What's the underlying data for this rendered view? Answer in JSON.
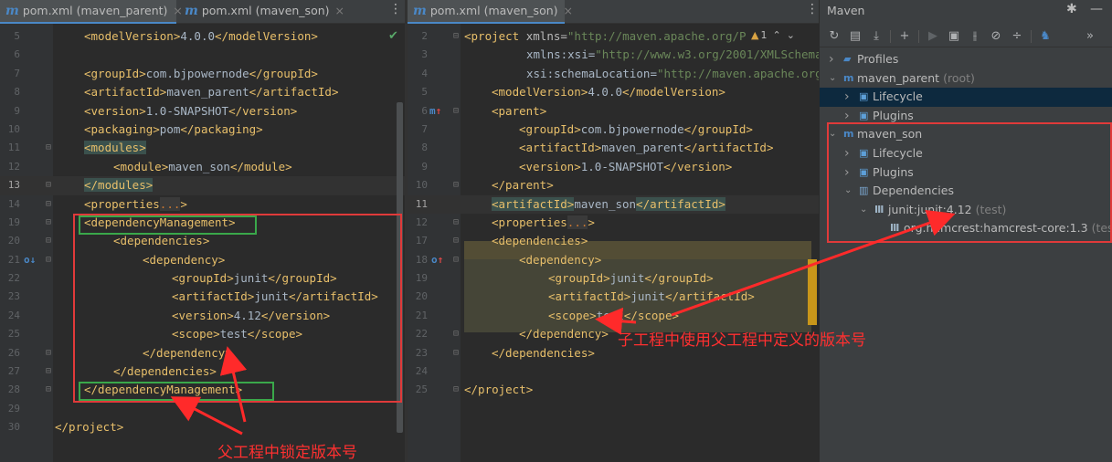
{
  "left_editor": {
    "tabs": [
      {
        "label": "pom.xml (maven_parent)",
        "active": true
      },
      {
        "label": "pom.xml (maven_son)",
        "active": false
      }
    ],
    "lines": [
      {
        "n": "5",
        "t": "<modelVersion>4.0.0</modelVersion>"
      },
      {
        "n": "6",
        "t": ""
      },
      {
        "n": "7",
        "t": "<groupId>com.bjpowernode</groupId>"
      },
      {
        "n": "8",
        "t": "<artifactId>maven_parent</artifactId>"
      },
      {
        "n": "9",
        "t": "<version>1.0-SNAPSHOT</version>"
      },
      {
        "n": "10",
        "t": "<packaging>pom</packaging>"
      },
      {
        "n": "11",
        "t": "<modules>"
      },
      {
        "n": "12",
        "t": "<module>maven_son</module>"
      },
      {
        "n": "13",
        "t": "</modules>"
      },
      {
        "n": "14",
        "t": "<properties...>"
      },
      {
        "n": "19",
        "t": "<dependencyManagement>"
      },
      {
        "n": "20",
        "t": "<dependencies>"
      },
      {
        "n": "21",
        "t": "<dependency>"
      },
      {
        "n": "22",
        "t": "<groupId>junit</groupId>"
      },
      {
        "n": "23",
        "t": "<artifactId>junit</artifactId>"
      },
      {
        "n": "24",
        "t": "<version>4.12</version>"
      },
      {
        "n": "25",
        "t": "<scope>test</scope>"
      },
      {
        "n": "26",
        "t": "</dependency>"
      },
      {
        "n": "27",
        "t": "</dependencies>"
      },
      {
        "n": "28",
        "t": "</dependencyManagement>"
      },
      {
        "n": "29",
        "t": ""
      },
      {
        "n": "30",
        "t": "</project>"
      }
    ],
    "annotation": "父工程中锁定版本号"
  },
  "right_editor": {
    "tabs": [
      {
        "label": "pom.xml (maven_son)",
        "active": true
      }
    ],
    "warning_count": "1",
    "lines": [
      {
        "n": "2",
        "t": "<project xmlns=\"http://maven.apache.org/P"
      },
      {
        "n": "3",
        "t": "xmlns:xsi=\"http://www.w3.org/2001/XMLSchema"
      },
      {
        "n": "4",
        "t": "xsi:schemaLocation=\"http://maven.apache.org"
      },
      {
        "n": "5",
        "t": "<modelVersion>4.0.0</modelVersion>"
      },
      {
        "n": "6",
        "t": "<parent>"
      },
      {
        "n": "7",
        "t": "<groupId>com.bjpowernode</groupId>"
      },
      {
        "n": "8",
        "t": "<artifactId>maven_parent</artifactId>"
      },
      {
        "n": "9",
        "t": "<version>1.0-SNAPSHOT</version>"
      },
      {
        "n": "10",
        "t": "</parent>"
      },
      {
        "n": "11",
        "t": "<artifactId>maven_son</artifactId>"
      },
      {
        "n": "12",
        "t": "<properties...>"
      },
      {
        "n": "17",
        "t": "<dependencies>"
      },
      {
        "n": "18",
        "t": "<dependency>"
      },
      {
        "n": "19",
        "t": "<groupId>junit</groupId>"
      },
      {
        "n": "20",
        "t": "<artifactId>junit</artifactId>"
      },
      {
        "n": "21",
        "t": "<scope>test</scope>"
      },
      {
        "n": "22",
        "t": "</dependency>"
      },
      {
        "n": "23",
        "t": "</dependencies>"
      },
      {
        "n": "24",
        "t": ""
      },
      {
        "n": "25",
        "t": "</project>"
      }
    ],
    "annotation": "子工程中使用父工程中定义的版本号"
  },
  "maven_panel": {
    "title": "Maven",
    "tree": [
      {
        "label": "Profiles",
        "suffix": "",
        "depth": 0,
        "expanded": false,
        "icon": "profiles-icon"
      },
      {
        "label": "maven_parent",
        "suffix": "(root)",
        "depth": 0,
        "expanded": true,
        "icon": "maven-module-icon"
      },
      {
        "label": "Lifecycle",
        "suffix": "",
        "depth": 1,
        "expanded": false,
        "icon": "lifecycle-icon",
        "selected": true
      },
      {
        "label": "Plugins",
        "suffix": "",
        "depth": 1,
        "expanded": false,
        "icon": "plugins-icon"
      },
      {
        "label": "maven_son",
        "suffix": "",
        "depth": 0,
        "expanded": true,
        "icon": "maven-module-icon"
      },
      {
        "label": "Lifecycle",
        "suffix": "",
        "depth": 1,
        "expanded": false,
        "icon": "lifecycle-icon"
      },
      {
        "label": "Plugins",
        "suffix": "",
        "depth": 1,
        "expanded": false,
        "icon": "plugins-icon"
      },
      {
        "label": "Dependencies",
        "suffix": "",
        "depth": 1,
        "expanded": true,
        "icon": "dependencies-icon"
      },
      {
        "label": "junit:junit:4.12",
        "suffix": "(test)",
        "depth": 2,
        "expanded": true,
        "icon": "library-icon"
      },
      {
        "label": "org.hamcrest:hamcrest-core:1.3",
        "suffix": "(test)",
        "depth": 3,
        "expanded": false,
        "icon": "library-icon",
        "leaf": true
      }
    ]
  },
  "colors": {
    "annotation_red": "#ff3030",
    "box_green": "#3aa84a",
    "editor_bg": "#2b2b2b",
    "tag": "#e8bf6a",
    "string": "#6a8759"
  }
}
